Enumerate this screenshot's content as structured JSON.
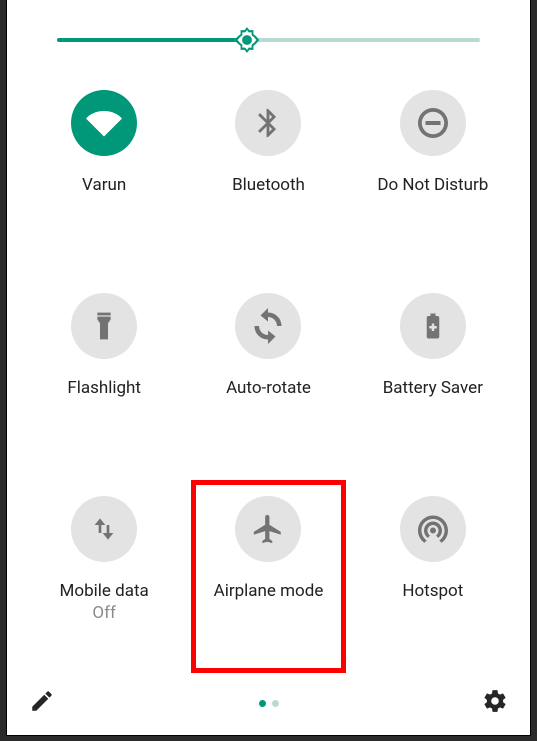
{
  "brightness": {
    "percent": 45
  },
  "tiles": {
    "wifi": {
      "label": "Varun",
      "active": true
    },
    "bluetooth": {
      "label": "Bluetooth",
      "active": false
    },
    "dnd": {
      "label": "Do Not Disturb",
      "active": false
    },
    "flashlight": {
      "label": "Flashlight",
      "active": false
    },
    "autorotate": {
      "label": "Auto-rotate",
      "active": false
    },
    "battery": {
      "label": "Battery Saver",
      "active": false
    },
    "mobiledata": {
      "label": "Mobile data",
      "sub": "Off",
      "active": false
    },
    "airplane": {
      "label": "Airplane mode",
      "active": false,
      "highlighted": true
    },
    "hotspot": {
      "label": "Hotspot",
      "active": false
    }
  },
  "pager": {
    "current": 1,
    "total": 2
  },
  "colors": {
    "accent": "#009879",
    "inactive_tile": "#e3e3e3",
    "highlight": "#ff0000"
  }
}
